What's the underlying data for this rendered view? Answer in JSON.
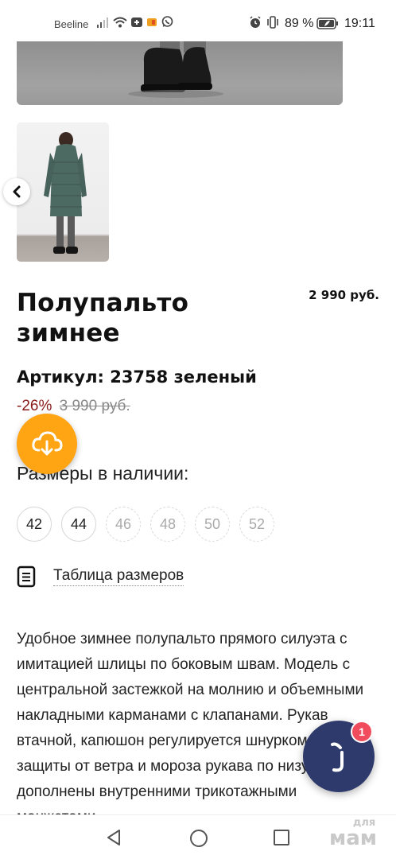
{
  "status_bar": {
    "carrier": "Beeline",
    "battery": "89 %",
    "time": "19:11"
  },
  "product": {
    "title_line1": "Полупальто",
    "title_line2": "зимнее",
    "price": "2 990 руб.",
    "article": "Артикул: 23758 зеленый",
    "discount": "-26%",
    "old_price": "3 990 руб."
  },
  "sizes": {
    "heading": "Размеры в наличии:",
    "items": [
      {
        "label": "42",
        "available": true
      },
      {
        "label": "44",
        "available": true
      },
      {
        "label": "46",
        "available": false
      },
      {
        "label": "48",
        "available": false
      },
      {
        "label": "50",
        "available": false
      },
      {
        "label": "52",
        "available": false
      }
    ],
    "table_link": "Таблица размеров"
  },
  "description": "Удобное зимнее полупальто прямого силуэта с имитацией шлицы по боковым швам. Модель с центральной застежкой на молнию и объемными накладными карманами с клапанами. Рукав втачной, капюшон регулируется шнурком. Для защиты от ветра и мороза рукава по низу дополнены внутренними трикотажными манжетами.",
  "chat": {
    "badge_count": "1"
  },
  "watermark": {
    "top": "для",
    "bottom": "мам"
  },
  "colors": {
    "accent_orange": "#ffa412",
    "chat_navy": "#2e3a6b",
    "badge_red": "#f04c5e",
    "discount_red": "#8b1a1a"
  },
  "icons": [
    "signal-icon",
    "wifi-icon",
    "notification-plus-icon",
    "sim-icon",
    "whatsapp-icon",
    "alarm-icon",
    "vibrate-icon",
    "battery-icon",
    "chevron-left-icon",
    "cloud-download-icon",
    "document-icon",
    "chat-logo-icon",
    "nav-back-icon",
    "nav-home-icon",
    "nav-recent-icon"
  ]
}
